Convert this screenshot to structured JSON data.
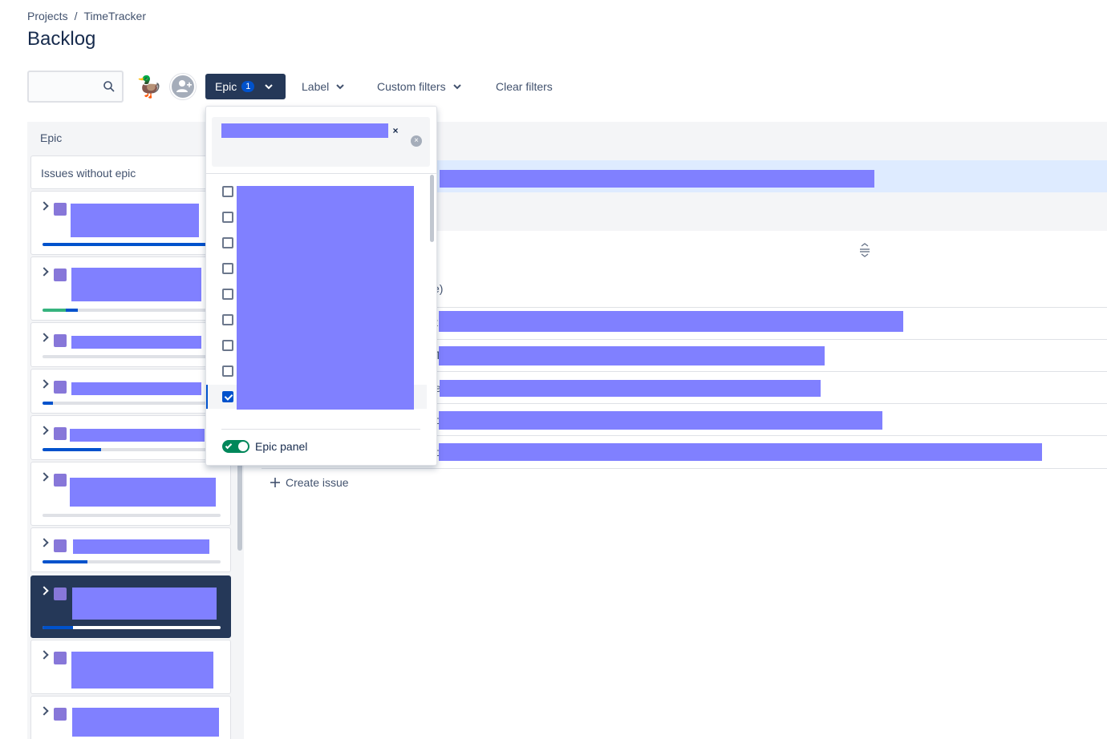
{
  "breadcrumb": {
    "items": [
      "Projects",
      "/",
      "TimeTracker"
    ]
  },
  "page": {
    "title": "Backlog"
  },
  "toolbar": {
    "search_placeholder": "",
    "epic_label": "Epic",
    "epic_count": "1",
    "label_label": "Label",
    "custom_filters_label": "Custom filters",
    "clear_filters_label": "Clear filters"
  },
  "epic_panel": {
    "header": "Epic",
    "issues_without_epic": "Issues without epic",
    "cards": [
      {
        "progress_done": 0.0,
        "progress_in_progress": 1.0
      },
      {
        "progress_done": 0.13,
        "progress_in_progress": 0.07
      },
      {
        "progress_done": 0.0,
        "progress_in_progress": 0.0
      },
      {
        "progress_done": 0.0,
        "progress_in_progress": 0.06
      },
      {
        "progress_done": 0.0,
        "progress_in_progress": 0.33
      },
      {
        "progress_done": 0.0,
        "progress_in_progress": 0.0
      },
      {
        "progress_done": 0.0,
        "progress_in_progress": 0.25
      },
      {
        "progress_done": 0.0,
        "progress_in_progress": 0.17,
        "selected": true
      },
      {
        "progress_done": 0.0,
        "progress_in_progress": 0.0
      },
      {
        "progress_done": 0.0,
        "progress_in_progress": 0.0
      }
    ]
  },
  "backlog": {
    "partial_fragments": [
      "e)",
      "t",
      "T",
      "e",
      "o",
      "o"
    ],
    "create_issue_label": "Create issue"
  },
  "epic_dropdown": {
    "options_checked": [
      false,
      false,
      false,
      false,
      false,
      false,
      false,
      false,
      true
    ],
    "epic_panel_toggle_label": "Epic panel",
    "epic_panel_enabled": true
  },
  "colors": {
    "epic_button_bg": "#253858",
    "accent_blue": "#0052cc",
    "toggle_green": "#00875a",
    "epic_purple": "#8777d9"
  }
}
